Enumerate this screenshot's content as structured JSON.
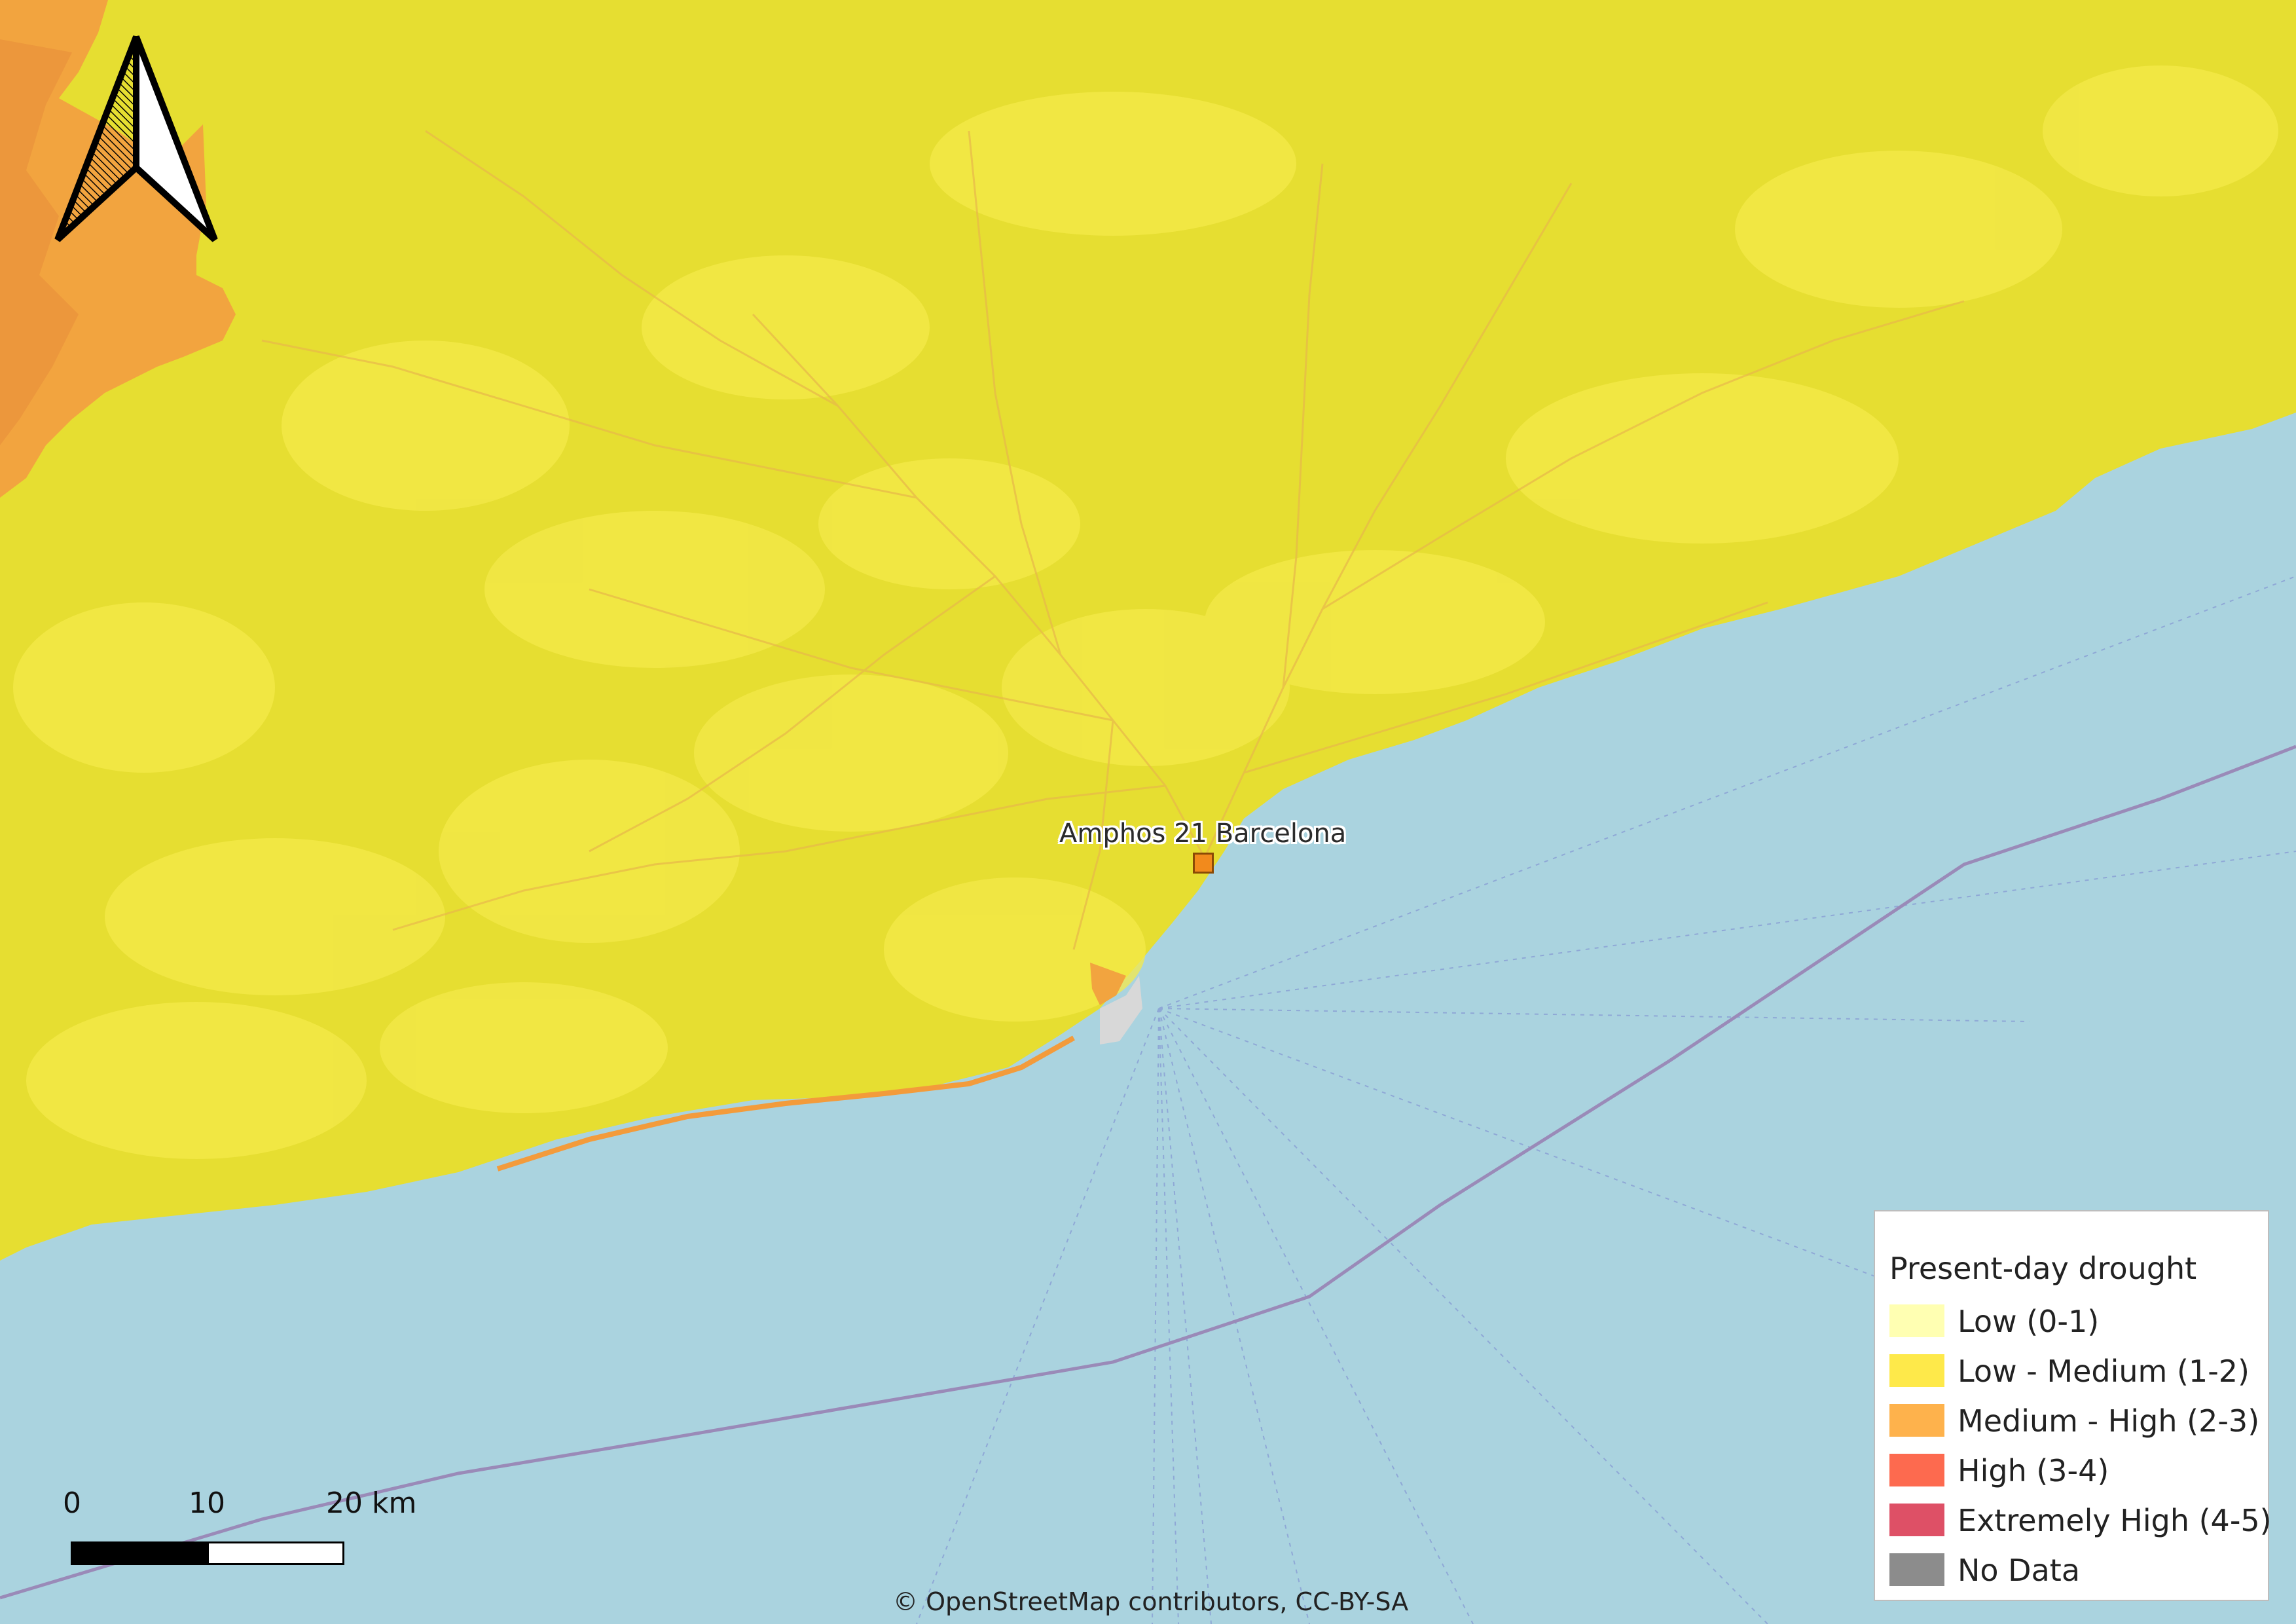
{
  "map": {
    "colors": {
      "sea": "#aad3df",
      "low_medium": "#e6de31",
      "low_medium_light": "#f4e94a",
      "medium_high": "#f2a43f",
      "coast_orange": "#f39b3b",
      "roads": "#e8b84a",
      "shipping_lines": "#8fa8d6"
    }
  },
  "site": {
    "label": "Amphos 21 Barcelona",
    "marker_color": "#f28a1c"
  },
  "legend": {
    "title": "Present-day drought",
    "items": [
      {
        "label": "Low (0-1)",
        "color": "#ffffb2"
      },
      {
        "label": "Low - Medium (1-2)",
        "color": "#fee94a"
      },
      {
        "label": "Medium - High (2-3)",
        "color": "#feb24c"
      },
      {
        "label": "High (3-4)",
        "color": "#fd6a4f"
      },
      {
        "label": "Extremely High (4-5)",
        "color": "#de5066"
      },
      {
        "label": "No Data",
        "color": "#8c8c8c"
      }
    ]
  },
  "scale_bar": {
    "labels": [
      "0",
      "10",
      "20 km"
    ]
  },
  "north_arrow": {
    "icon": "north-arrow-icon"
  },
  "attribution": "© OpenStreetMap contributors, CC-BY-SA"
}
